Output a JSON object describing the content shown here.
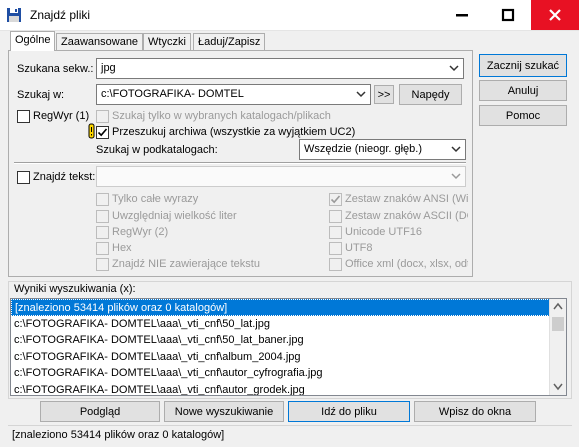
{
  "window": {
    "title": "Znajdź pliki"
  },
  "tabs": [
    {
      "label": "Ogólne",
      "active": true
    },
    {
      "label": "Zaawansowane"
    },
    {
      "label": "Wtyczki"
    },
    {
      "label": "Ładuj/Zapisz"
    }
  ],
  "general": {
    "search_for_label": "Szukana sekw.:",
    "search_for_value": "jpg",
    "search_in_label": "Szukaj w:",
    "search_in_value": "c:\\FOTOGRAFIKA- DOMTEL",
    "browse_label": ">>",
    "drives_label": "Napędy",
    "regex1_label": "RegWyr (1)",
    "only_selected_label": "Szukaj tylko w wybranych katalogach/plikach",
    "archives_label": "Przeszukuj archiwa (wszystkie za wyjątkiem UC2)",
    "subdirs_label": "Szukaj w podkatalogach:",
    "subdirs_value": "Wszędzie (nieogr. głęb.)",
    "find_text_label": "Znajdź tekst:",
    "find_text_value": "",
    "options_left": [
      "Tylko całe wyrazy",
      "Uwzględniaj wielkość liter",
      "RegWyr (2)",
      "Hex",
      "Znajdź NIE zawierające tekstu"
    ],
    "options_right": [
      "Zestaw znaków ANSI (Wi",
      "Zestaw znaków ASCII (DC",
      "Unicode UTF16",
      "UTF8",
      "Office xml (docx, xlsx, odt i"
    ]
  },
  "side_buttons": {
    "start": "Zacznij szukać",
    "cancel": "Anuluj",
    "help": "Pomoc"
  },
  "results": {
    "label": "Wyniki wyszukiwania (x):",
    "items": [
      "[znaleziono 53414 plików oraz 0 katalogów]",
      "c:\\FOTOGRAFIKA- DOMTEL\\aaa\\_vti_cnf\\50_lat.jpg",
      "c:\\FOTOGRAFIKA- DOMTEL\\aaa\\_vti_cnf\\50_lat_baner.jpg",
      "c:\\FOTOGRAFIKA- DOMTEL\\aaa\\_vti_cnf\\album_2004.jpg",
      "c:\\FOTOGRAFIKA- DOMTEL\\aaa\\_vti_cnf\\autor_cyfrografia.jpg",
      "c:\\FOTOGRAFIKA- DOMTEL\\aaa\\_vti_cnf\\autor_grodek.jpg"
    ]
  },
  "bottom_buttons": {
    "view": "Podgląd",
    "new_search": "Nowe wyszukiwanie",
    "goto_file": "Idź do pliku",
    "feed_window": "Wpisz do okna"
  },
  "status": "[znaleziono 53414 plików oraz 0 katalogów]"
}
